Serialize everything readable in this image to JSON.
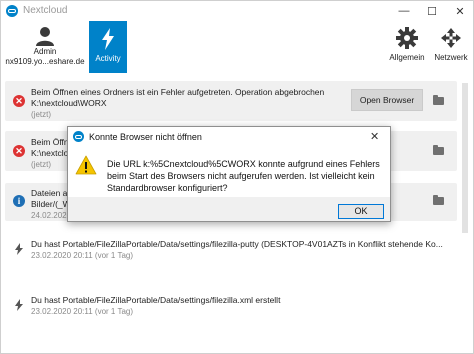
{
  "window": {
    "title": "Nextcloud",
    "controls": {
      "minimize": "—",
      "maximize": "☐",
      "close": "✕"
    }
  },
  "toolbar": {
    "account": {
      "name": "Admin",
      "server": "nx9109.yo...eshare.de"
    },
    "activity_label": "Activity",
    "settings_label": "Allgemein",
    "network_label": "Netzwerk"
  },
  "activities": [
    {
      "icon": "error-icon",
      "lines": [
        "Beim Öffnen eines Ordners ist ein Fehler aufgetreten. Operation abgebrochen",
        "K:\\nextcloud\\WORX"
      ],
      "time": "(jetzt)",
      "button": "Open Browser"
    },
    {
      "icon": "error-icon",
      "lines": [
        "Beim Öffnen eines Ordners",
        "K:\\nextcloud\\"
      ],
      "time": "(jetzt)"
    },
    {
      "icon": "info-icon",
      "lines": [
        "Dateien au",
        "Bilder/(_We"
      ],
      "time": "24.02.2020"
    },
    {
      "icon": "lightning-icon",
      "lines": [
        "Du hast Portable/FileZillaPortable/Data/settings/filezilla-putty (DESKTOP-4V01AZTs in Konflikt stehende Ko..."
      ],
      "time": "23.02.2020 20:11 (vor 1 Tag)"
    },
    {
      "icon": "lightning-icon",
      "lines": [
        "Du hast Portable/FileZillaPortable/Data/settings/filezilla.xml erstellt"
      ],
      "time": "23.02.2020 20:11 (vor 1 Tag)"
    }
  ],
  "dialog": {
    "title": "Konnte Browser nicht öffnen",
    "message": "Die URL k:%5Cnextcloud%5CWORX konnte aufgrund eines Fehlers beim Start des Browsers nicht aufgerufen werden. Ist vielleicht kein Standardbrowser konfiguriert?",
    "ok_label": "OK",
    "close": "✕"
  },
  "colors": {
    "accent": "#0082c9",
    "error": "#d33333",
    "warning": "#f5c400"
  }
}
